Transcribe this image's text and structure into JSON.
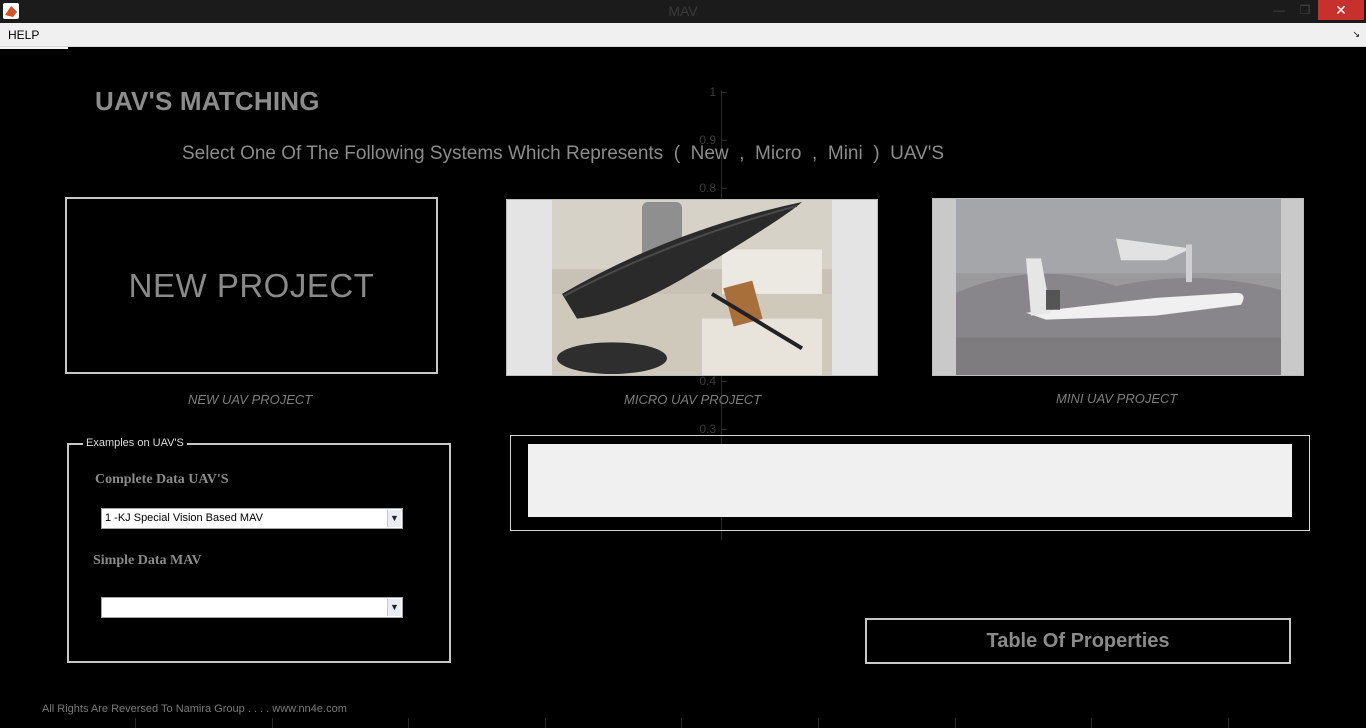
{
  "window": {
    "title": "MAV",
    "minimize_icon": "minimize-icon",
    "maximize_icon": "maximize-icon",
    "close_icon": "close-icon",
    "close_glyph": "✕",
    "minimize_glyph": "—",
    "maximize_glyph": "❐"
  },
  "menu": {
    "items": [
      {
        "label": "HELP"
      }
    ],
    "corner_glyph": "↘"
  },
  "background_axis": {
    "tick_labels": [
      "1",
      "0.9",
      "0.8",
      "0.4",
      "0.3"
    ]
  },
  "header": {
    "title": "UAV'S MATCHING",
    "instruction": "Select One Of The Following Systems Which Represents  (  New  ,  Micro  ,  Mini  )  UAV'S"
  },
  "tiles": [
    {
      "label": "NEW PROJECT",
      "caption": "NEW UAV PROJECT"
    },
    {
      "image": "micro-uav-photo",
      "caption": "MICRO UAV PROJECT"
    },
    {
      "image": "mini-uav-photo",
      "caption": "MINI UAV PROJECT"
    }
  ],
  "examples": {
    "legend": "Examples on UAV'S",
    "complete_label": "Complete Data UAV'S",
    "complete_value": "1 -KJ Special Vision Based MAV",
    "simple_label": "Simple Data MAV",
    "simple_value": "",
    "dropdown_glyph": "▼"
  },
  "display": {
    "text": ""
  },
  "buttons": {
    "table_properties": "Table Of Properties"
  },
  "footer": {
    "text": "All Rights Are Reversed To Namira Group . . . .  www.nn4e.com"
  },
  "colors": {
    "background": "#000000",
    "text": "#8c8c8c",
    "close": "#c7312d"
  }
}
